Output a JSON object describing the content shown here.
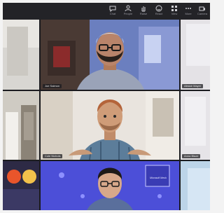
{
  "toolbar": {
    "buttons": [
      {
        "name": "chat",
        "label": "Chat",
        "icon": "chat-icon"
      },
      {
        "name": "people",
        "label": "People",
        "icon": "people-icon"
      },
      {
        "name": "raise",
        "label": "Raise",
        "icon": "hand-icon"
      },
      {
        "name": "react",
        "label": "React",
        "icon": "smile-icon"
      },
      {
        "name": "view",
        "label": "View",
        "icon": "grid-icon"
      },
      {
        "name": "more",
        "label": "More",
        "icon": "more-icon"
      },
      {
        "name": "camera",
        "label": "Camera",
        "icon": "camera-icon"
      }
    ]
  },
  "participants": {
    "top_center": "Joe Salmon",
    "top_right": "Alistair Mayer",
    "mid_center": "Cole Nichols",
    "mid_right": "Anna Blaze"
  },
  "slide_text": "Microsoft Mesh",
  "colors": {
    "accent": "#4c4fd8",
    "toolbar": "#232327",
    "nametag": "#1e1e22"
  }
}
